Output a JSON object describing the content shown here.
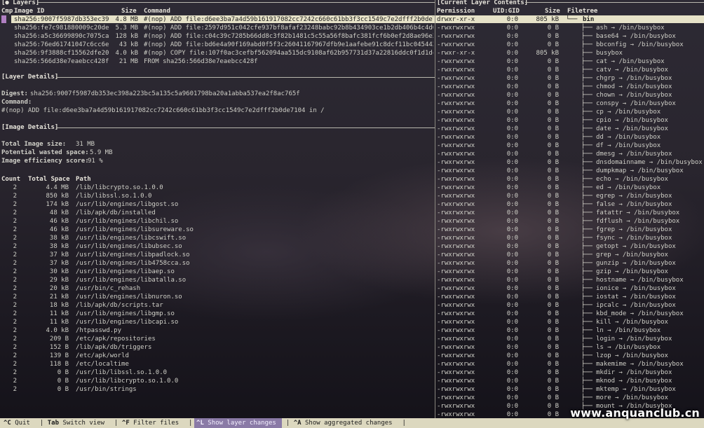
{
  "layers_pane": {
    "title": "[● Layers]",
    "columns": {
      "cmp": "Cmp",
      "image_id": "Image ID",
      "size": "Size",
      "command": "Command"
    },
    "rows": [
      {
        "id": "sha256:9007f5987db353ec39",
        "size": "4.8 MB",
        "command": "#(nop) ADD file:d6ee3ba7a4d59b161917082cc7242c660c61bb3f3cc1549c7e2dfff2b0de71"
      },
      {
        "id": "sha256:fe7c981880009c20de",
        "size": "5.3 MB",
        "command": "#(nop) ADD file:2597d951c042cfe937bf8afaf23248babc92b8b434903ce1b2db406b4c4d61"
      },
      {
        "id": "sha256:a5c36699890c7075ca",
        "size": "128 kB",
        "command": "#(nop) ADD file:c04c39c7285b66dd8c3f82b1481c5c55a56f8bafc381fcf6b0ef2d8ae96e3c"
      },
      {
        "id": "sha256:76ed61741047c6cc6e",
        "size": "43 kB",
        "command": "#(nop) ADD file:bd6e4a90f169abd0f5f3c26041167967dfb9e1aafebe91c8dcf11bc0454438"
      },
      {
        "id": "sha256:9f3888cf15562dfe20",
        "size": "4.0 kB",
        "command": "#(nop) COPY file:107f0ac3cefbf562094aa515dc9108af62b957731d37a22816ddc0f1d1dc6"
      },
      {
        "id": "sha256:566d38e7eaebcc428f",
        "size": "21 MB",
        "command": "FROM sha256:566d38e7eaebcc428f"
      }
    ]
  },
  "layer_details": {
    "title": "[Layer Details]",
    "digest_label": "Digest:",
    "digest_value": "sha256:9007f5987db353ec398a223bc5a135c5a9601798ba20a1abba537ea2f8ac765f",
    "command_label": "Command:",
    "command_value": "#(nop) ADD file:d6ee3ba7a4d59b161917082cc7242c660c61bb3f3cc1549c7e2dfff2b0de7104 in /"
  },
  "image_details": {
    "title": "[Image Details]",
    "total_size_label": "Total Image size:",
    "total_size_value": "31 MB",
    "wasted_label": "Potential wasted space:",
    "wasted_value": "5.9 MB",
    "efficiency_label": "Image efficiency score:",
    "efficiency_value": "91 %",
    "columns": {
      "count": "Count",
      "total_space": "Total Space",
      "path": "Path"
    },
    "rows": [
      {
        "count": "2",
        "space": "4.4 MB",
        "path": "/lib/libcrypto.so.1.0.0"
      },
      {
        "count": "2",
        "space": "850 kB",
        "path": "/lib/libssl.so.1.0.0"
      },
      {
        "count": "2",
        "space": "174 kB",
        "path": "/usr/lib/engines/libgost.so"
      },
      {
        "count": "2",
        "space": "48 kB",
        "path": "/lib/apk/db/installed"
      },
      {
        "count": "2",
        "space": "46 kB",
        "path": "/usr/lib/engines/libchil.so"
      },
      {
        "count": "2",
        "space": "46 kB",
        "path": "/usr/lib/engines/libsureware.so"
      },
      {
        "count": "2",
        "space": "38 kB",
        "path": "/usr/lib/engines/libcswift.so"
      },
      {
        "count": "2",
        "space": "38 kB",
        "path": "/usr/lib/engines/libubsec.so"
      },
      {
        "count": "2",
        "space": "37 kB",
        "path": "/usr/lib/engines/libpadlock.so"
      },
      {
        "count": "2",
        "space": "37 kB",
        "path": "/usr/lib/engines/lib4758cca.so"
      },
      {
        "count": "2",
        "space": "30 kB",
        "path": "/usr/lib/engines/libaep.so"
      },
      {
        "count": "2",
        "space": "29 kB",
        "path": "/usr/lib/engines/libatalla.so"
      },
      {
        "count": "2",
        "space": "20 kB",
        "path": "/usr/bin/c_rehash"
      },
      {
        "count": "2",
        "space": "21 kB",
        "path": "/usr/lib/engines/libnuron.so"
      },
      {
        "count": "2",
        "space": "18 kB",
        "path": "/lib/apk/db/scripts.tar"
      },
      {
        "count": "2",
        "space": "11 kB",
        "path": "/usr/lib/engines/libgmp.so"
      },
      {
        "count": "2",
        "space": "11 kB",
        "path": "/usr/lib/engines/libcapi.so"
      },
      {
        "count": "2",
        "space": "4.0 kB",
        "path": "/htpasswd.py"
      },
      {
        "count": "2",
        "space": "209 B",
        "path": "/etc/apk/repositories"
      },
      {
        "count": "2",
        "space": "152 B",
        "path": "/lib/apk/db/triggers"
      },
      {
        "count": "2",
        "space": "139 B",
        "path": "/etc/apk/world"
      },
      {
        "count": "2",
        "space": "118 B",
        "path": "/etc/localtime"
      },
      {
        "count": "2",
        "space": "0 B",
        "path": "/usr/lib/libssl.so.1.0.0"
      },
      {
        "count": "2",
        "space": "0 B",
        "path": "/usr/lib/libcrypto.so.1.0.0"
      },
      {
        "count": "2",
        "space": "0 B",
        "path": "/usr/bin/strings"
      }
    ]
  },
  "contents_pane": {
    "title": "[Current Layer Contents]",
    "columns": {
      "permission": "Permission",
      "uidgid": "UID:GID",
      "size": "Size",
      "filetree": "Filetree"
    },
    "rows": [
      {
        "perm": "drwxr-xr-x",
        "uid": "0:0",
        "size": "805 kB",
        "name": "bin",
        "root": true
      },
      {
        "perm": "-rwxrwxrwx",
        "uid": "0:0",
        "size": "0 B",
        "name": "ash → /bin/busybox"
      },
      {
        "perm": "-rwxrwxrwx",
        "uid": "0:0",
        "size": "0 B",
        "name": "base64 → /bin/busybox"
      },
      {
        "perm": "-rwxrwxrwx",
        "uid": "0:0",
        "size": "0 B",
        "name": "bbconfig → /bin/busybox"
      },
      {
        "perm": "-rwxr-xr-x",
        "uid": "0:0",
        "size": "805 kB",
        "name": "busybox"
      },
      {
        "perm": "-rwxrwxrwx",
        "uid": "0:0",
        "size": "0 B",
        "name": "cat → /bin/busybox"
      },
      {
        "perm": "-rwxrwxrwx",
        "uid": "0:0",
        "size": "0 B",
        "name": "catv → /bin/busybox"
      },
      {
        "perm": "-rwxrwxrwx",
        "uid": "0:0",
        "size": "0 B",
        "name": "chgrp → /bin/busybox"
      },
      {
        "perm": "-rwxrwxrwx",
        "uid": "0:0",
        "size": "0 B",
        "name": "chmod → /bin/busybox"
      },
      {
        "perm": "-rwxrwxrwx",
        "uid": "0:0",
        "size": "0 B",
        "name": "chown → /bin/busybox"
      },
      {
        "perm": "-rwxrwxrwx",
        "uid": "0:0",
        "size": "0 B",
        "name": "conspy → /bin/busybox"
      },
      {
        "perm": "-rwxrwxrwx",
        "uid": "0:0",
        "size": "0 B",
        "name": "cp → /bin/busybox"
      },
      {
        "perm": "-rwxrwxrwx",
        "uid": "0:0",
        "size": "0 B",
        "name": "cpio → /bin/busybox"
      },
      {
        "perm": "-rwxrwxrwx",
        "uid": "0:0",
        "size": "0 B",
        "name": "date → /bin/busybox"
      },
      {
        "perm": "-rwxrwxrwx",
        "uid": "0:0",
        "size": "0 B",
        "name": "dd → /bin/busybox"
      },
      {
        "perm": "-rwxrwxrwx",
        "uid": "0:0",
        "size": "0 B",
        "name": "df → /bin/busybox"
      },
      {
        "perm": "-rwxrwxrwx",
        "uid": "0:0",
        "size": "0 B",
        "name": "dmesg → /bin/busybox"
      },
      {
        "perm": "-rwxrwxrwx",
        "uid": "0:0",
        "size": "0 B",
        "name": "dnsdomainname → /bin/busybox"
      },
      {
        "perm": "-rwxrwxrwx",
        "uid": "0:0",
        "size": "0 B",
        "name": "dumpkmap → /bin/busybox"
      },
      {
        "perm": "-rwxrwxrwx",
        "uid": "0:0",
        "size": "0 B",
        "name": "echo → /bin/busybox"
      },
      {
        "perm": "-rwxrwxrwx",
        "uid": "0:0",
        "size": "0 B",
        "name": "ed → /bin/busybox"
      },
      {
        "perm": "-rwxrwxrwx",
        "uid": "0:0",
        "size": "0 B",
        "name": "egrep → /bin/busybox"
      },
      {
        "perm": "-rwxrwxrwx",
        "uid": "0:0",
        "size": "0 B",
        "name": "false → /bin/busybox"
      },
      {
        "perm": "-rwxrwxrwx",
        "uid": "0:0",
        "size": "0 B",
        "name": "fatattr → /bin/busybox"
      },
      {
        "perm": "-rwxrwxrwx",
        "uid": "0:0",
        "size": "0 B",
        "name": "fdflush → /bin/busybox"
      },
      {
        "perm": "-rwxrwxrwx",
        "uid": "0:0",
        "size": "0 B",
        "name": "fgrep → /bin/busybox"
      },
      {
        "perm": "-rwxrwxrwx",
        "uid": "0:0",
        "size": "0 B",
        "name": "fsync → /bin/busybox"
      },
      {
        "perm": "-rwxrwxrwx",
        "uid": "0:0",
        "size": "0 B",
        "name": "getopt → /bin/busybox"
      },
      {
        "perm": "-rwxrwxrwx",
        "uid": "0:0",
        "size": "0 B",
        "name": "grep → /bin/busybox"
      },
      {
        "perm": "-rwxrwxrwx",
        "uid": "0:0",
        "size": "0 B",
        "name": "gunzip → /bin/busybox"
      },
      {
        "perm": "-rwxrwxrwx",
        "uid": "0:0",
        "size": "0 B",
        "name": "gzip → /bin/busybox"
      },
      {
        "perm": "-rwxrwxrwx",
        "uid": "0:0",
        "size": "0 B",
        "name": "hostname → /bin/busybox"
      },
      {
        "perm": "-rwxrwxrwx",
        "uid": "0:0",
        "size": "0 B",
        "name": "ionice → /bin/busybox"
      },
      {
        "perm": "-rwxrwxrwx",
        "uid": "0:0",
        "size": "0 B",
        "name": "iostat → /bin/busybox"
      },
      {
        "perm": "-rwxrwxrwx",
        "uid": "0:0",
        "size": "0 B",
        "name": "ipcalc → /bin/busybox"
      },
      {
        "perm": "-rwxrwxrwx",
        "uid": "0:0",
        "size": "0 B",
        "name": "kbd_mode → /bin/busybox"
      },
      {
        "perm": "-rwxrwxrwx",
        "uid": "0:0",
        "size": "0 B",
        "name": "kill → /bin/busybox"
      },
      {
        "perm": "-rwxrwxrwx",
        "uid": "0:0",
        "size": "0 B",
        "name": "ln → /bin/busybox"
      },
      {
        "perm": "-rwxrwxrwx",
        "uid": "0:0",
        "size": "0 B",
        "name": "login → /bin/busybox"
      },
      {
        "perm": "-rwxrwxrwx",
        "uid": "0:0",
        "size": "0 B",
        "name": "ls → /bin/busybox"
      },
      {
        "perm": "-rwxrwxrwx",
        "uid": "0:0",
        "size": "0 B",
        "name": "lzop → /bin/busybox"
      },
      {
        "perm": "-rwxrwxrwx",
        "uid": "0:0",
        "size": "0 B",
        "name": "makemime → /bin/busybox"
      },
      {
        "perm": "-rwxrwxrwx",
        "uid": "0:0",
        "size": "0 B",
        "name": "mkdir → /bin/busybox"
      },
      {
        "perm": "-rwxrwxrwx",
        "uid": "0:0",
        "size": "0 B",
        "name": "mknod → /bin/busybox"
      },
      {
        "perm": "-rwxrwxrwx",
        "uid": "0:0",
        "size": "0 B",
        "name": "mktemp → /bin/busybox"
      },
      {
        "perm": "-rwxrwxrwx",
        "uid": "0:0",
        "size": "0 B",
        "name": "more → /bin/busybox"
      },
      {
        "perm": "-rwxrwxrwx",
        "uid": "0:0",
        "size": "0 B",
        "name": "mount → /bin/busybox"
      },
      {
        "perm": "-rwxrwxrwx",
        "uid": "0:0",
        "size": "0 B",
        "name": ""
      }
    ]
  },
  "status_bar": {
    "items": [
      {
        "key": "^C",
        "label": "Quit"
      },
      {
        "key": "Tab",
        "label": "Switch view"
      },
      {
        "key": "^F",
        "label": "Filter files"
      },
      {
        "key": "^L",
        "label": "Show layer changes",
        "active": true
      },
      {
        "key": "^A",
        "label": "Show aggregated changes"
      }
    ]
  },
  "watermark": "www.anquanclub.cn",
  "colors": {
    "selection": "#e6e2c8",
    "cursor": "#b07fc2",
    "status_bg": "#dcd8bf",
    "status_active": "#8a7aa6"
  }
}
